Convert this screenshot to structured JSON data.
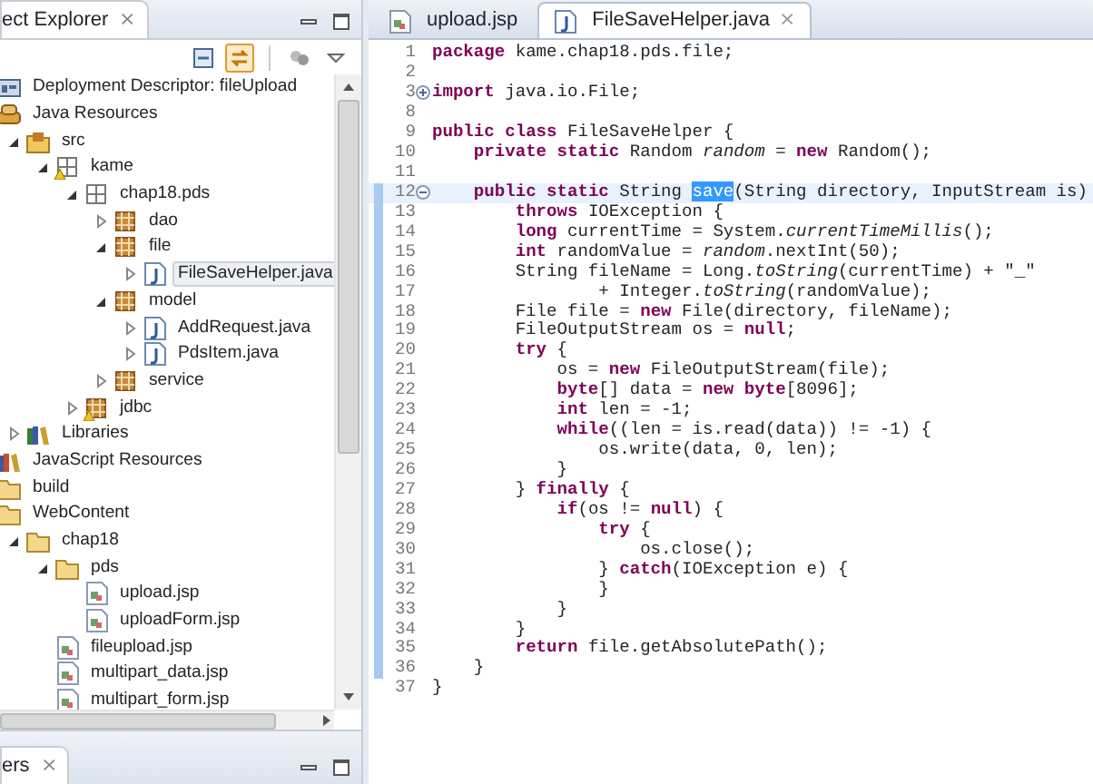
{
  "explorer": {
    "title": "ect Explorer",
    "close": "⨯",
    "tree": [
      {
        "label": "Deployment Descriptor: fileUpload",
        "kind": "deployment",
        "warning": false,
        "selected": false
      },
      {
        "label": "Java Resources",
        "kind": "javares",
        "warning": false,
        "selected": false,
        "children": [
          {
            "label": "src",
            "kind": "srcfolder",
            "expanded": true,
            "warning": false,
            "selected": false,
            "children": [
              {
                "label": "kame",
                "kind": "emptypackage",
                "expanded": true,
                "warning": true,
                "selected": false,
                "children": [
                  {
                    "label": "chap18.pds",
                    "kind": "emptypackage",
                    "expanded": true,
                    "warning": false,
                    "selected": false,
                    "children": [
                      {
                        "label": "dao",
                        "kind": "package",
                        "expanded": false,
                        "warning": false,
                        "selected": false
                      },
                      {
                        "label": "file",
                        "kind": "package",
                        "expanded": true,
                        "warning": false,
                        "selected": false,
                        "children": [
                          {
                            "label": "FileSaveHelper.java",
                            "kind": "java",
                            "expanded": false,
                            "warning": false,
                            "selected": true
                          }
                        ]
                      },
                      {
                        "label": "model",
                        "kind": "package",
                        "expanded": true,
                        "warning": false,
                        "selected": false,
                        "children": [
                          {
                            "label": "AddRequest.java",
                            "kind": "java",
                            "expanded": false,
                            "warning": false,
                            "selected": false
                          },
                          {
                            "label": "PdsItem.java",
                            "kind": "java",
                            "expanded": false,
                            "warning": false,
                            "selected": false
                          }
                        ]
                      },
                      {
                        "label": "service",
                        "kind": "package",
                        "expanded": false,
                        "warning": false,
                        "selected": false
                      }
                    ]
                  },
                  {
                    "label": "jdbc",
                    "kind": "package",
                    "expanded": false,
                    "warning": true,
                    "selected": false
                  }
                ]
              }
            ]
          },
          {
            "label": "Libraries",
            "kind": "libraries",
            "expanded": false,
            "warning": false,
            "selected": false
          }
        ]
      },
      {
        "label": "JavaScript Resources",
        "kind": "jsres",
        "warning": false,
        "selected": false
      },
      {
        "label": "build",
        "kind": "folder",
        "warning": false,
        "selected": false
      },
      {
        "label": "WebContent",
        "kind": "folder",
        "warning": false,
        "selected": false,
        "children": [
          {
            "label": "chap18",
            "kind": "folder",
            "expanded": true,
            "warning": false,
            "selected": false,
            "children": [
              {
                "label": "pds",
                "kind": "folder",
                "expanded": true,
                "warning": false,
                "selected": false,
                "children": [
                  {
                    "label": "upload.jsp",
                    "kind": "jsp",
                    "warning": false,
                    "selected": false
                  },
                  {
                    "label": "uploadForm.jsp",
                    "kind": "jsp",
                    "warning": false,
                    "selected": false
                  }
                ]
              },
              {
                "label": "fileupload.jsp",
                "kind": "jsp",
                "warning": false,
                "selected": false
              },
              {
                "label": "multipart_data.jsp",
                "kind": "jsp",
                "warning": false,
                "selected": false
              },
              {
                "label": "multipart_form.jsp",
                "kind": "jsp",
                "warning": false,
                "selected": false
              }
            ]
          }
        ]
      }
    ],
    "toolbar": [
      {
        "kind": "collapse",
        "selected": false
      },
      {
        "kind": "link",
        "selected": true
      },
      {
        "kind": "filter",
        "selected": false
      },
      {
        "kind": "menu",
        "selected": false
      }
    ]
  },
  "bottom_panel": {
    "title": "ers",
    "close": "⨯"
  },
  "editor": {
    "tabs": [
      {
        "label": "upload.jsp",
        "kind": "jsp",
        "selected": false
      },
      {
        "label": "FileSaveHelper.java",
        "kind": "java",
        "selected": true,
        "close": "⨯"
      }
    ],
    "lines": [
      {
        "number": "1",
        "code": "**package** kame.chap18.pds.file;",
        "current": false,
        "marked": false
      },
      {
        "number": "2",
        "current": false,
        "marked": false
      },
      {
        "number": "3",
        "code": "**import** java.io.File;",
        "folded": true,
        "current": false,
        "marked": false
      },
      {
        "number": "8",
        "current": false,
        "marked": false
      },
      {
        "number": "9",
        "code": "**public** **class** FileSaveHelper {",
        "current": false,
        "marked": false
      },
      {
        "number": "10",
        "code": "    **private** **static** Random *random* = **new** Random();",
        "current": false,
        "marked": false
      },
      {
        "number": "11",
        "current": false,
        "marked": false
      },
      {
        "number": "12",
        "code": "    **public** **static** String ",
        "selection": "save",
        "code_after": "(String directory, InputStream is)",
        "folded": false,
        "current": true,
        "marked": true
      },
      {
        "number": "13",
        "code": "        **throws** IOException {",
        "current": false,
        "marked": true
      },
      {
        "number": "14",
        "code": "        **long** currentTime = System.*currentTimeMillis*();",
        "current": false,
        "marked": true
      },
      {
        "number": "15",
        "code": "        **int** randomValue = *random*.nextInt(50);",
        "current": false,
        "marked": true
      },
      {
        "number": "16",
        "code": "        String fileName = Long.*toString*(currentTime) + \"_\"",
        "current": false,
        "marked": true
      },
      {
        "number": "17",
        "code": "                + Integer.*toString*(randomValue);",
        "current": false,
        "marked": true
      },
      {
        "number": "18",
        "code": "        File file = **new** File(directory, fileName);",
        "current": false,
        "marked": true
      },
      {
        "number": "19",
        "code": "        FileOutputStream os = **null**;",
        "current": false,
        "marked": true
      },
      {
        "number": "20",
        "code": "        **try** {",
        "current": false,
        "marked": true
      },
      {
        "number": "21",
        "code": "            os = **new** FileOutputStream(file);",
        "current": false,
        "marked": true
      },
      {
        "number": "22",
        "code": "            **byte**[] data = **new** **byte**[8096];",
        "current": false,
        "marked": true
      },
      {
        "number": "23",
        "code": "            **int** len = -1;",
        "current": false,
        "marked": true
      },
      {
        "number": "24",
        "code": "            **while**((len = is.read(data)) != -1) {",
        "current": false,
        "marked": true
      },
      {
        "number": "25",
        "code": "                os.write(data, 0, len);",
        "current": false,
        "marked": true
      },
      {
        "number": "26",
        "code": "            }",
        "current": false,
        "marked": true
      },
      {
        "number": "27",
        "code": "        } **finally** {",
        "current": false,
        "marked": true
      },
      {
        "number": "28",
        "code": "            **if**(os != **null**) {",
        "current": false,
        "marked": true
      },
      {
        "number": "29",
        "code": "                **try** {",
        "current": false,
        "marked": true
      },
      {
        "number": "30",
        "code": "                    os.close();",
        "current": false,
        "marked": true
      },
      {
        "number": "31",
        "code": "                } **catch**(IOException e) {",
        "current": false,
        "marked": true
      },
      {
        "number": "32",
        "code": "                }",
        "current": false,
        "marked": true
      },
      {
        "number": "33",
        "code": "            }",
        "current": false,
        "marked": true
      },
      {
        "number": "34",
        "code": "        }",
        "current": false,
        "marked": true
      },
      {
        "number": "35",
        "code": "        **return** file.getAbsolutePath();",
        "current": false,
        "marked": true
      },
      {
        "number": "36",
        "code": "    }",
        "current": false,
        "marked": true
      },
      {
        "number": "37",
        "code": "}",
        "current": false,
        "marked": false
      }
    ]
  }
}
